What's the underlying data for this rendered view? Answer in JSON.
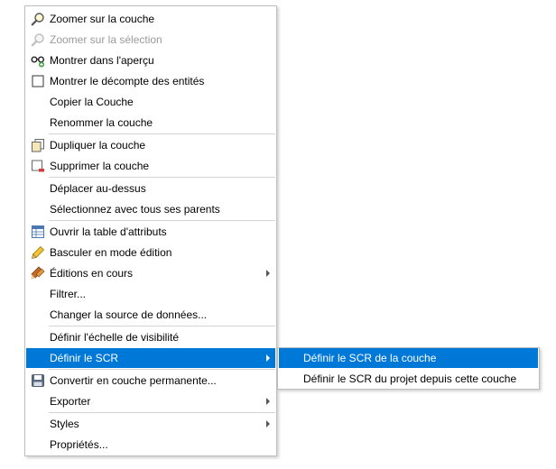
{
  "context_menu": {
    "items": [
      {
        "label": "Zoomer sur la couche",
        "icon": "zoom-icon"
      },
      {
        "label": "Zoomer sur la sélection",
        "icon": "zoom-icon",
        "disabled": true
      },
      {
        "label": "Montrer dans l'aperçu",
        "icon": "overview-icon"
      },
      {
        "label": "Montrer le décompte des entités",
        "icon": "checkbox",
        "checked": false
      },
      {
        "label": "Copier la Couche"
      },
      {
        "label": "Renommer la couche"
      },
      {
        "label": "Dupliquer la couche",
        "icon": "duplicate-layer-icon"
      },
      {
        "label": "Supprimer la couche",
        "icon": "remove-layer-icon"
      },
      {
        "label": "Déplacer au-dessus"
      },
      {
        "label": "Sélectionnez avec tous ses parents"
      },
      {
        "label": "Ouvrir la table d'attributs",
        "icon": "attribute-table-icon"
      },
      {
        "label": "Basculer en mode édition",
        "icon": "pencil-icon"
      },
      {
        "label": "Éditions en cours",
        "icon": "edits-icon",
        "submenu": true
      },
      {
        "label": "Filtrer..."
      },
      {
        "label": "Changer la source de données..."
      },
      {
        "label": "Définir l'échelle de visibilité"
      },
      {
        "label": "Définir le SCR",
        "submenu": true,
        "highlighted": true
      },
      {
        "label": "Convertir en couche permanente...",
        "icon": "save-icon"
      },
      {
        "label": "Exporter",
        "submenu": true
      },
      {
        "label": "Styles",
        "submenu": true
      },
      {
        "label": "Propriétés..."
      }
    ]
  },
  "crs_submenu": {
    "items": [
      {
        "label": "Définir le SCR de la couche",
        "highlighted": true
      },
      {
        "label": "Définir le SCR du projet depuis cette couche"
      }
    ]
  },
  "colors": {
    "highlight": "#0078d7",
    "disabled_text": "#9a9a9a",
    "separator": "#d4d4d4"
  }
}
